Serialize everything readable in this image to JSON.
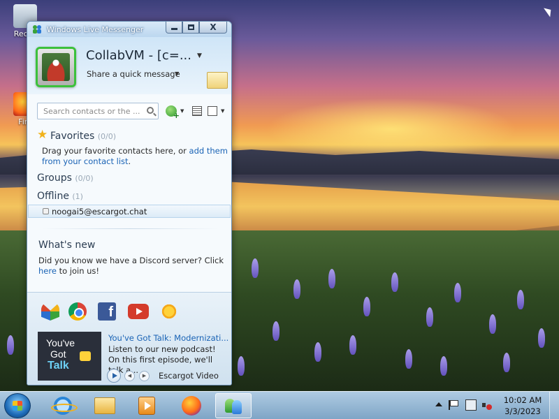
{
  "desktop": {
    "icons": [
      {
        "label": "Recyc"
      },
      {
        "label": "Fire"
      }
    ]
  },
  "window": {
    "title": "Windows Live Messenger",
    "controls": {
      "minimize": "–",
      "maximize": "□",
      "close": "X"
    }
  },
  "profile": {
    "display_name": "CollabVM - [c=...",
    "quick_message": "Share a quick message"
  },
  "search": {
    "placeholder": "Search contacts or the ..."
  },
  "favorites": {
    "title": "Favorites",
    "count": "(0/0)",
    "text_prefix": "Drag your favorite contacts here, or ",
    "link": "add them from your contact list",
    "text_suffix": "."
  },
  "groups": {
    "title": "Groups",
    "count": "(0/0)"
  },
  "offline": {
    "title": "Offline",
    "count": "(1)",
    "contacts": [
      {
        "email": "noogai5@escargot.chat"
      }
    ]
  },
  "whats_new": {
    "title": "What's new",
    "text": "Did you know we have a Discord server? Click ",
    "link": "here",
    "text_suffix": " to join us!"
  },
  "services": [
    "windows-live-icon",
    "chrome-icon",
    "facebook-icon",
    "youtube-icon",
    "sun-icon"
  ],
  "video": {
    "thumb_line1": "You've",
    "thumb_line2": "Got",
    "thumb_line3": "Talk",
    "title": "You've Got Talk: Modernizati...",
    "description": "Listen to our new podcast! On this first episode, we'll talk a...",
    "source": "Escargot Video"
  },
  "taskbar": {
    "pinned": [
      "internet-explorer",
      "windows-explorer",
      "media-player",
      "firefox",
      "windows-live-messenger"
    ],
    "clock_time": "10:02 AM",
    "clock_date": "3/3/2023"
  },
  "colors": {
    "accent_link": "#1a63b5",
    "window_border": "#6b8fb4",
    "presence_online": "#3cc13c"
  }
}
